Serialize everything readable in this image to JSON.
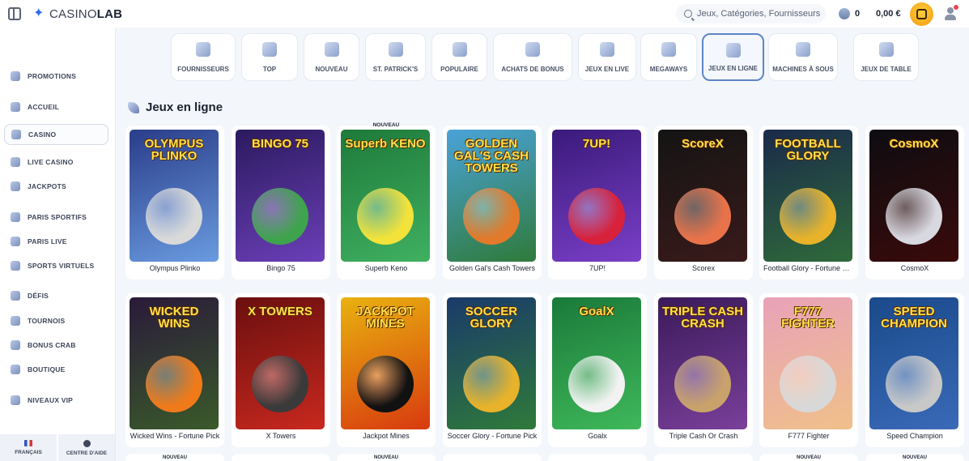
{
  "header": {
    "logo_text_light": "CASINO",
    "logo_text_bold": "LAB",
    "search_placeholder": "Jeux, Catégories, Fournisseurs",
    "coins": "0",
    "balance": "0,00 €"
  },
  "sidebar": {
    "items": [
      {
        "label": "PROMOTIONS",
        "active": false
      },
      {
        "label": "ACCUEIL",
        "active": false
      },
      {
        "label": "CASINO",
        "active": true
      },
      {
        "label": "LIVE CASINO",
        "active": false
      },
      {
        "label": "JACKPOTS",
        "active": false
      },
      {
        "label": "PARIS SPORTIFS",
        "active": false
      },
      {
        "label": "PARIS LIVE",
        "active": false
      },
      {
        "label": "SPORTS VIRTUELS",
        "active": false
      },
      {
        "label": "DÉFIS",
        "active": false
      },
      {
        "label": "TOURNOIS",
        "active": false
      },
      {
        "label": "BONUS CRAB",
        "active": false
      },
      {
        "label": "BOUTIQUE",
        "active": false
      },
      {
        "label": "NIVEAUX VIP",
        "active": false
      }
    ],
    "footer": {
      "language_label": "FRANÇAIS",
      "help_label": "CENTRE D'AIDE"
    }
  },
  "categories": [
    {
      "label": "FOURNISSEURS",
      "active": false
    },
    {
      "label": "TOP",
      "active": false
    },
    {
      "label": "NOUVEAU",
      "active": false
    },
    {
      "label": "ST. PATRICK'S",
      "active": false
    },
    {
      "label": "POPULAIRE",
      "active": false
    },
    {
      "label": "ACHATS DE BONUS",
      "active": false
    },
    {
      "label": "JEUX EN LIVE",
      "active": false
    },
    {
      "label": "MEGAWAYS",
      "active": false
    },
    {
      "label": "JEUX EN LIGNE",
      "active": true
    },
    {
      "label": "MACHINES À SOUS",
      "active": false
    },
    {
      "label": "JEUX DE TABLE",
      "active": false
    }
  ],
  "section": {
    "title": "Jeux en ligne"
  },
  "games_row1": [
    {
      "name": "Olympus Plinko",
      "thumb_title": "OLYMPUS PLINKO",
      "colors": [
        "#2a3d8a",
        "#6a9be0"
      ],
      "accent": "#d9d9d9",
      "badge": ""
    },
    {
      "name": "Bingo 75",
      "thumb_title": "BINGO 75",
      "colors": [
        "#2b1a5e",
        "#6b3fb8"
      ],
      "accent": "#3fa34d",
      "badge": ""
    },
    {
      "name": "Superb Keno",
      "thumb_title": "Superb KENO",
      "colors": [
        "#1e7a3a",
        "#3fb060"
      ],
      "accent": "#f2e23a",
      "badge": "NOUVEAU"
    },
    {
      "name": "Golden Gal's Cash Towers",
      "thumb_title": "GOLDEN GAL'S CASH TOWERS",
      "colors": [
        "#4aa3d8",
        "#2f7a3a"
      ],
      "accent": "#e3792a",
      "badge": ""
    },
    {
      "name": "7UP!",
      "thumb_title": "7UP!",
      "colors": [
        "#3a1a7a",
        "#7a3fc8"
      ],
      "accent": "#d8213a",
      "badge": ""
    },
    {
      "name": "Scorex",
      "thumb_title": "ScoreX",
      "colors": [
        "#141414",
        "#3a1a1a"
      ],
      "accent": "#e8734a",
      "badge": ""
    },
    {
      "name": "Football Glory - Fortune Pick",
      "thumb_title": "FOOTBALL GLORY",
      "colors": [
        "#1a2a4a",
        "#2f6a3a"
      ],
      "accent": "#e8b22a",
      "badge": ""
    },
    {
      "name": "CosmoX",
      "thumb_title": "CosmoX",
      "colors": [
        "#0d0d12",
        "#3a0a0a"
      ],
      "accent": "#d8d8e0",
      "badge": ""
    }
  ],
  "games_row2": [
    {
      "name": "Wicked Wins - Fortune Pick",
      "thumb_title": "WICKED WINS",
      "colors": [
        "#2a1a3a",
        "#3a5a2a"
      ],
      "accent": "#f07a1a",
      "badge": ""
    },
    {
      "name": "X Towers",
      "thumb_title": "X TOWERS",
      "colors": [
        "#6a0f0f",
        "#c8281e"
      ],
      "accent": "#3a3a3a",
      "badge": ""
    },
    {
      "name": "Jackpot Mines",
      "thumb_title": "JACKPOT MINES",
      "colors": [
        "#e8b20f",
        "#d83a0f"
      ],
      "accent": "#111111",
      "badge": ""
    },
    {
      "name": "Soccer Glory - Fortune Pick",
      "thumb_title": "SOCCER GLORY",
      "colors": [
        "#1a3a6a",
        "#2f7a3a"
      ],
      "accent": "#e8b22a",
      "badge": ""
    },
    {
      "name": "Goalx",
      "thumb_title": "GoalX",
      "colors": [
        "#1a7a3a",
        "#3fb85a"
      ],
      "accent": "#f2f2f2",
      "badge": ""
    },
    {
      "name": "Triple Cash Or Crash",
      "thumb_title": "TRIPLE CASH CRASH",
      "colors": [
        "#3a1a5a",
        "#7a3f9a"
      ],
      "accent": "#c8a26a",
      "badge": ""
    },
    {
      "name": "F777 Fighter",
      "thumb_title": "F777 FIGHTER",
      "colors": [
        "#e8a2b8",
        "#f0c08a"
      ],
      "accent": "#d8d8d8",
      "badge": ""
    },
    {
      "name": "Speed Champion",
      "thumb_title": "SPEED CHAMPION",
      "colors": [
        "#1a4a8a",
        "#3a6ab8"
      ],
      "accent": "#c8c8c8",
      "badge": ""
    }
  ],
  "row3_badges": [
    "NOUVEAU",
    "NOUVEAU",
    "NOUVEAU",
    "NOUVEAU"
  ]
}
